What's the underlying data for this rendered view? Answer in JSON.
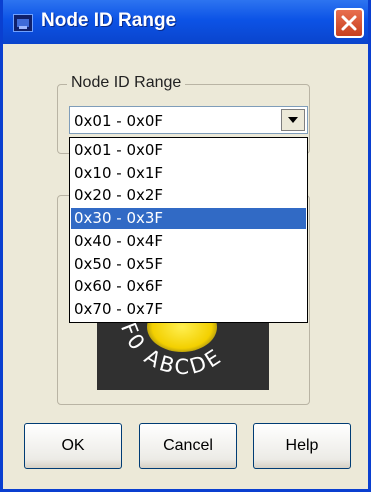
{
  "window": {
    "title": "Node ID Range",
    "icon": "app-icon",
    "close_icon": "close-icon"
  },
  "group": {
    "label": "Node ID Range"
  },
  "combo": {
    "value": "0x01 - 0x0F",
    "arrow_icon": "chevron-down-icon"
  },
  "dropdown": {
    "options": [
      "0x01 - 0x0F",
      "0x10 - 0x1F",
      "0x20 - 0x2F",
      "0x30 - 0x3F",
      "0x40 - 0x4F",
      "0x50 - 0x5F",
      "0x60 - 0x6F",
      "0x70 - 0x7F"
    ],
    "highlighted_index": 3
  },
  "dial": {
    "label": "EF0 ABCDE"
  },
  "buttons": {
    "ok": "OK",
    "cancel": "Cancel",
    "help": "Help"
  },
  "colors": {
    "titlebar": "#0c53e6",
    "highlight": "#316ac5",
    "close": "#d9532f",
    "dialog": "#ece9d8"
  }
}
